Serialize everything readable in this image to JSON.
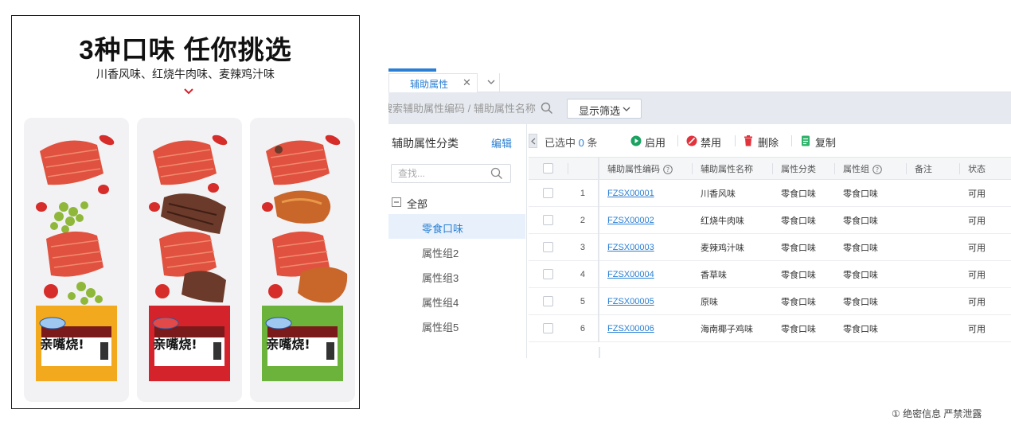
{
  "poster": {
    "title": "3种口味 任你挑选",
    "subtitle": "川香风味、红烧牛肉味、麦辣鸡汁味",
    "package_brand": "亲嘴烧!",
    "colors": {
      "card1_package": "#f2a91e",
      "card2_package": "#d4232b",
      "card3_package": "#6bb33a"
    }
  },
  "tabs": {
    "active": "辅助属性"
  },
  "toolbar": {
    "search_placeholder": "搜索辅助属性编码 / 辅助属性名称",
    "filter_label": "显示筛选"
  },
  "category": {
    "title": "辅助属性分类",
    "edit": "编辑",
    "search_placeholder": "查找...",
    "root": "全部",
    "items": [
      "零食口味",
      "属性组2",
      "属性组3",
      "属性组4",
      "属性组5"
    ],
    "active_index": 0
  },
  "grid": {
    "selected_prefix": "已选中",
    "selected_count": "0",
    "selected_suffix": "条",
    "actions": {
      "enable": "启用",
      "disable": "禁用",
      "delete": "删除",
      "copy": "复制"
    },
    "columns": [
      "辅助属性编码",
      "辅助属性名称",
      "属性分类",
      "属性组",
      "备注",
      "状态"
    ],
    "rows": [
      {
        "idx": "1",
        "code": "FZSX00001",
        "name": "川香风味",
        "category": "零食口味",
        "group": "零食口味",
        "remark": "",
        "status": "可用"
      },
      {
        "idx": "2",
        "code": "FZSX00002",
        "name": "红烧牛肉味",
        "category": "零食口味",
        "group": "零食口味",
        "remark": "",
        "status": "可用"
      },
      {
        "idx": "3",
        "code": "FZSX00003",
        "name": "麦辣鸡汁味",
        "category": "零食口味",
        "group": "零食口味",
        "remark": "",
        "status": "可用"
      },
      {
        "idx": "4",
        "code": "FZSX00004",
        "name": "香草味",
        "category": "零食口味",
        "group": "零食口味",
        "remark": "",
        "status": "可用"
      },
      {
        "idx": "5",
        "code": "FZSX00005",
        "name": "原味",
        "category": "零食口味",
        "group": "零食口味",
        "remark": "",
        "status": "可用"
      },
      {
        "idx": "6",
        "code": "FZSX00006",
        "name": "海南椰子鸡味",
        "category": "零食口味",
        "group": "零食口味",
        "remark": "",
        "status": "可用"
      }
    ]
  },
  "footer": {
    "watermark": "① 绝密信息 严禁泄露"
  },
  "colors": {
    "accent": "#2a7fd4",
    "toolbar_bg": "#e6eaf0",
    "enable_icon": "#1aa260",
    "disable_icon": "#e2333c",
    "delete_icon": "#e2333c",
    "copy_icon": "#2fb36a"
  }
}
